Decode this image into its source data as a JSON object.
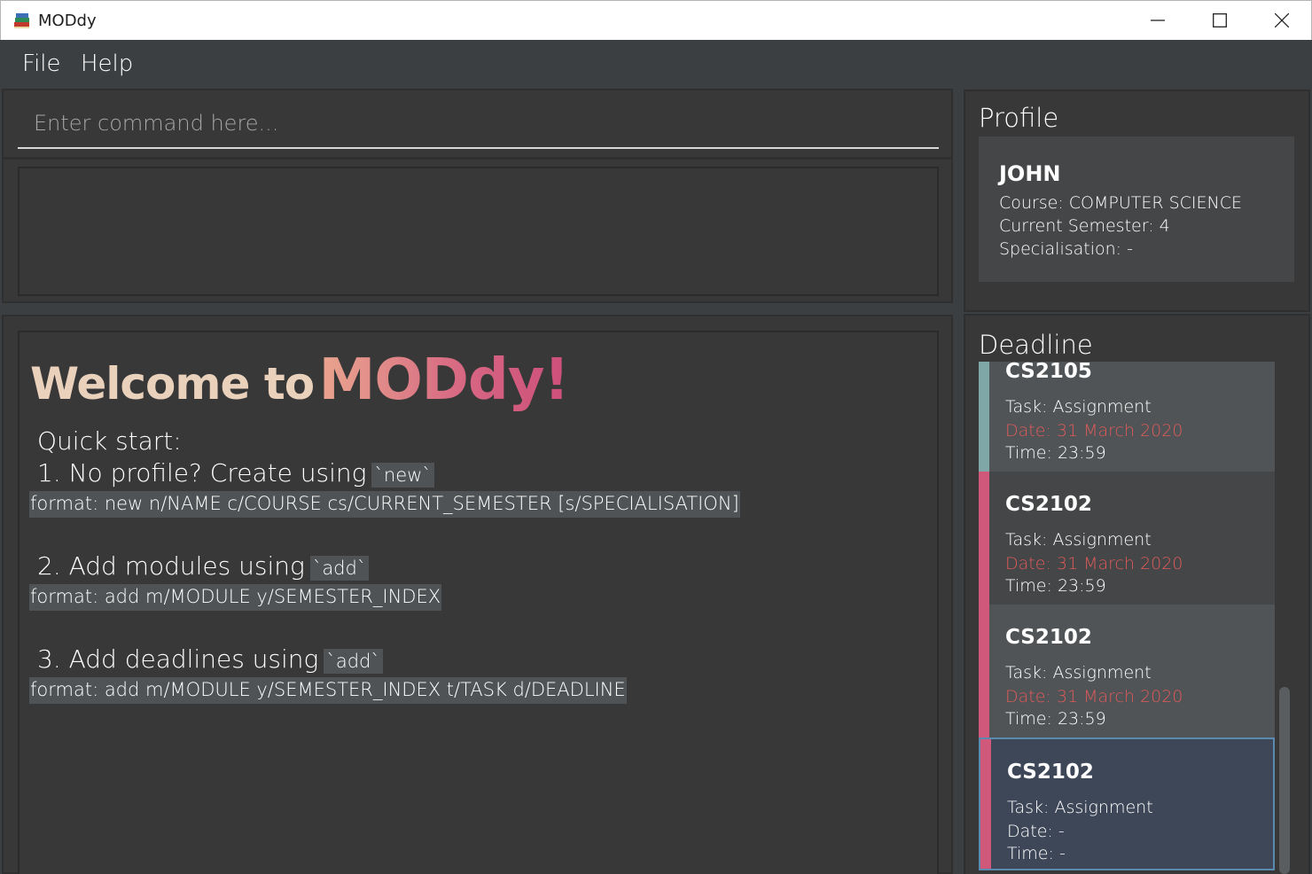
{
  "window": {
    "title": "MODdy",
    "controls": {
      "minimize": "minimize-icon",
      "maximize": "maximize-icon",
      "close": "close-icon"
    }
  },
  "menu": {
    "file": "File",
    "help": "Help"
  },
  "command": {
    "placeholder": "Enter command here...",
    "value": ""
  },
  "result": {
    "text": ""
  },
  "welcome": {
    "prefix": "Welcome to",
    "brand": "MODdy!",
    "quick_start": "Quick start:",
    "steps": [
      {
        "text": "1. No profile? Create using",
        "code": "`new`",
        "format": "format: new n/NAME c/COURSE cs/CURRENT_SEMESTER [s/SPECIALISATION]"
      },
      {
        "text": "2. Add modules using",
        "code": "`add`",
        "format": "format: add m/MODULE y/SEMESTER_INDEX"
      },
      {
        "text": "3. Add deadlines using",
        "code": "`add`",
        "format": "format: add m/MODULE y/SEMESTER_INDEX t/TASK d/DEADLINE"
      }
    ]
  },
  "profile": {
    "heading": "Profile",
    "name": "JOHN",
    "course": "Course: COMPUTER SCIENCE",
    "semester": "Current Semester: 4",
    "specialisation": "Specialisation: -"
  },
  "deadline": {
    "heading": "Deadline",
    "items": [
      {
        "code": "CS2105",
        "task": "Task: Assignment",
        "date": "Date: 31 March 2020",
        "time": "Time: 23:59",
        "bar_color": "#7fa7a8",
        "bg": "#505456",
        "overdue": true
      },
      {
        "code": "CS2102",
        "task": "Task: Assignment",
        "date": "Date: 31 March 2020",
        "time": "Time: 23:59",
        "bar_color": "#d0587a",
        "bg": "#444647",
        "overdue": true
      },
      {
        "code": "CS2102",
        "task": "Task: Assignment",
        "date": "Date: 31 March 2020",
        "time": "Time: 23:59",
        "bar_color": "#d0587a",
        "bg": "#505456",
        "overdue": true
      },
      {
        "code": "CS2102",
        "task": "Task: Assignment",
        "date": "Date: -",
        "time": "Time: -",
        "bar_color": "#d0587a",
        "bg": "#3e4758",
        "overdue": false,
        "selected": true
      }
    ]
  },
  "colors": {
    "background": "#3c3f41",
    "pane": "#383838",
    "accent_pink": "#d0587a",
    "overdue_red": "#e05a5a"
  }
}
